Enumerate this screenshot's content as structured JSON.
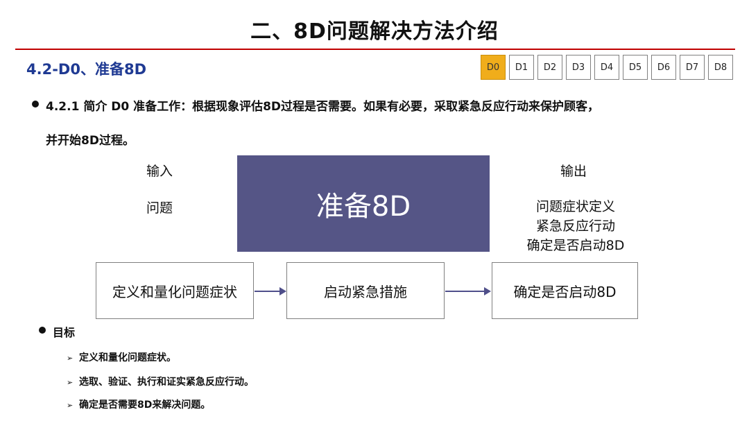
{
  "title": "二、8D问题解决方法介绍",
  "section_title": "4.2-D0、准备8D",
  "steps": [
    "D0",
    "D1",
    "D2",
    "D3",
    "D4",
    "D5",
    "D6",
    "D7",
    "D8"
  ],
  "intro": {
    "line1": "4.2.1 简介  D0 准备工作：根据现象评估8D过程是否需要。如果有必要，采取紧急反应行动来保护顾客，",
    "line2": "并开始8D过程。"
  },
  "diagram": {
    "input_label": "输入",
    "input_item": "问题",
    "center": "准备8D",
    "output_label": "输出",
    "outputs": [
      "问题症状定义",
      "紧急反应行动",
      "确定是否启动8D"
    ],
    "flow": [
      "定义和量化问题症状",
      "启动紧急措施",
      "确定是否启动8D"
    ]
  },
  "goals": {
    "title": "目标",
    "items": [
      "定义和量化问题症状。",
      "选取、验证、执行和证实紧急反应行动。",
      "确定是否需要8D来解决问题。"
    ]
  },
  "colors": {
    "accent_rule": "#c00000",
    "section": "#1f3a93",
    "active_step": "#f0ad1b",
    "center_box": "#555586"
  }
}
